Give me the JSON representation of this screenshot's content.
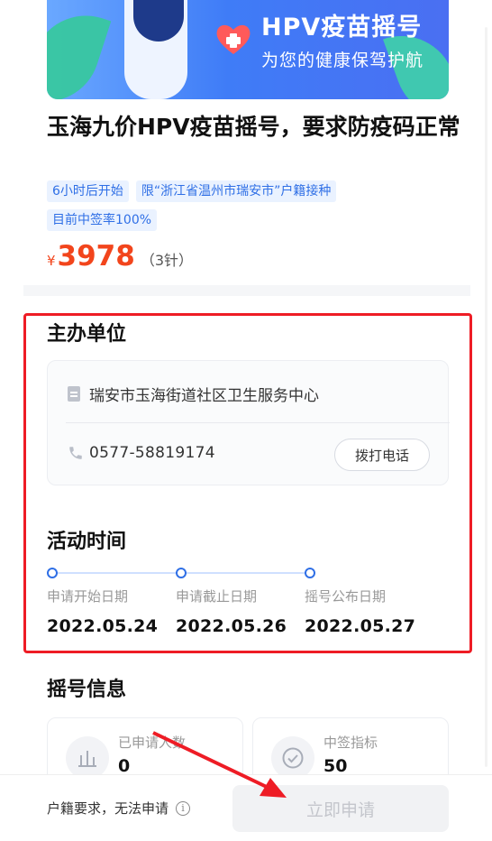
{
  "banner": {
    "title": "HPV疫苗摇号",
    "subtitle": "为您的健康保驾护航"
  },
  "event": {
    "title": "玉海九价HPV疫苗摇号，要求防疫码正常",
    "tags": [
      "6小时后开始",
      "限“浙江省温州市瑞安市”户籍接种",
      "目前中签率100%"
    ],
    "currency": "¥",
    "price": "3978",
    "doses": "（3针）"
  },
  "organizer": {
    "section_title": "主办单位",
    "name": "瑞安市玉海街道社区卫生服务中心",
    "phone": "0577-58819174",
    "call_label": "拨打电话"
  },
  "activity_time": {
    "section_title": "活动时间",
    "steps": [
      {
        "label": "申请开始日期",
        "date": "2022.05.24"
      },
      {
        "label": "申请截止日期",
        "date": "2022.05.26"
      },
      {
        "label": "摇号公布日期",
        "date": "2022.05.27"
      }
    ]
  },
  "lottery_info": {
    "section_title": "摇号信息",
    "stats": [
      {
        "label": "已申请人数",
        "value": "0",
        "icon": "bar-chart-icon"
      },
      {
        "label": "中签指标",
        "value": "50",
        "icon": "check-circle-icon"
      }
    ]
  },
  "bottom_bar": {
    "note": "户籍要求，无法申请",
    "apply_label": "立即申请"
  },
  "colors": {
    "accent": "#2f6fe6",
    "price": "#f2451c",
    "highlight": "#ee1c25"
  }
}
